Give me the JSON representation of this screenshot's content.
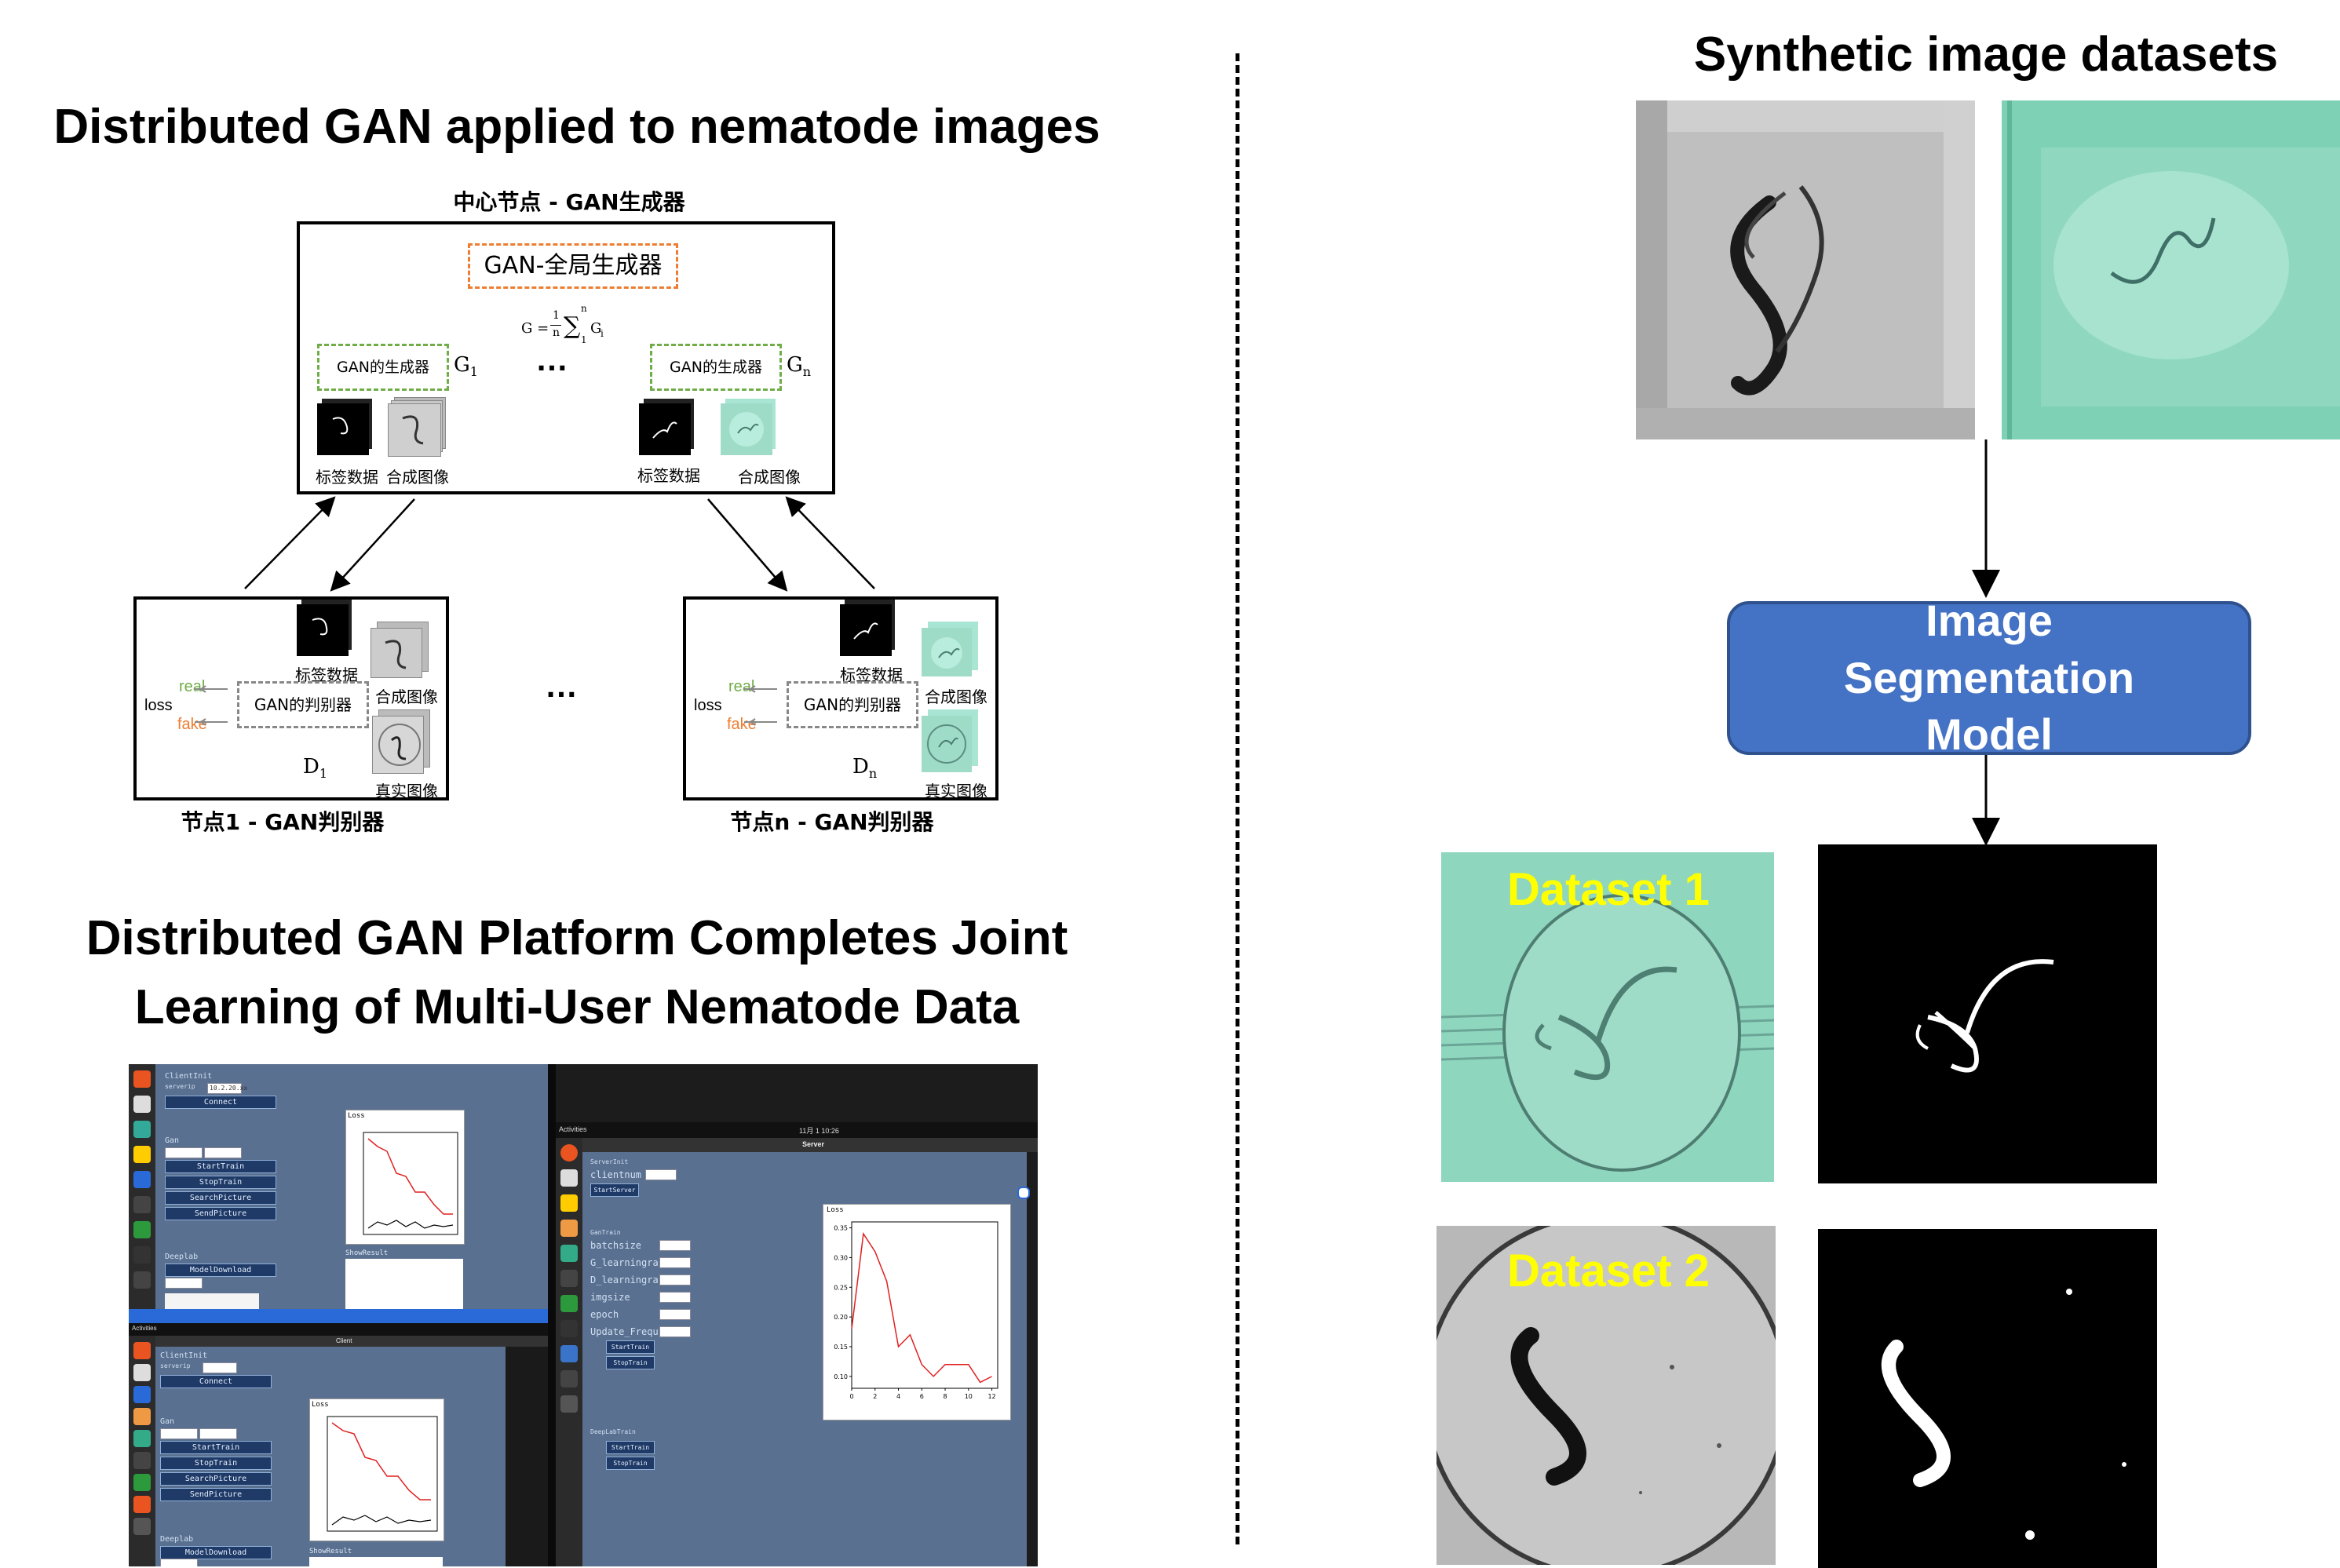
{
  "left": {
    "title": "Distributed GAN applied to nematode images",
    "center_node": {
      "label": "中心节点 - GAN生成器",
      "global_gen": "GAN-全局生成器",
      "formula_lhs": "G =",
      "formula_frac_num": "1",
      "formula_frac_den": "n",
      "formula_sum": "∑",
      "formula_sup": "n",
      "formula_sub": "1",
      "formula_term": "G",
      "formula_term_sub": "i",
      "gen_1": "GAN的生成器",
      "gen_n": "GAN的生成器",
      "g1": "G",
      "g1_sub": "1",
      "gn": "G",
      "gn_sub": "n",
      "ellipsis": "…",
      "label_data_1": "标签数据",
      "synth_1": "合成图像",
      "label_data_n": "标签数据",
      "synth_n": "合成图像"
    },
    "node_1": {
      "caption": "节点1 - GAN判别器",
      "label_data": "标签数据",
      "synth": "合成图像",
      "real_img": "真实图像",
      "disc": "GAN的判别器",
      "real": "real",
      "fake": "fake",
      "loss": "loss",
      "d": "D",
      "d_sub": "1"
    },
    "node_n": {
      "caption": "节点n - GAN判别器",
      "label_data": "标签数据",
      "synth": "合成图像",
      "real_img": "真实图像",
      "disc": "GAN的判别器",
      "real": "real",
      "fake": "fake",
      "loss": "loss",
      "d": "D",
      "d_sub": "n"
    },
    "nodes_ellipsis": "…",
    "title2_line1": "Distributed GAN Platform Completes Joint",
    "title2_line2": "Learning of Multi-User Nematode Data",
    "screenshot": {
      "client_top": {
        "client_init": "ClientInit",
        "server_ip": "serverip",
        "ip_value": "10.2.20.xx",
        "connect": "Connect",
        "gan": "Gan",
        "start_train": "StartTrain",
        "stop_train": "StopTrain",
        "search_picture": "SearchPicture",
        "send_picture": "SendPicture",
        "deeplab": "Deeplab",
        "model_download": "ModelDownload",
        "loss": "Loss",
        "show_result": "ShowResult"
      },
      "server": {
        "activities": "Activities",
        "clock": "11月 1  10:26",
        "window_title": "Server",
        "server_init": "ServerInit",
        "client_num": "clientnum",
        "start_server": "StartServer",
        "gan_train": "GanTrain",
        "batchsize": "batchsize",
        "g_lr": "G_learningra",
        "d_lr": "D_learningra",
        "imgsize": "imgsize",
        "epoch": "epoch",
        "update_freq": "Update_Frequ",
        "start_train": "StartTrain",
        "stop_train": "StopTrain",
        "deeplab_train": "DeepLabTrain",
        "dl_start": "StartTrain",
        "dl_stop": "StopTrain",
        "loss": "Loss"
      },
      "client_bottom": {
        "activities": "Activities",
        "window_title": "Client",
        "client_init": "ClientInit",
        "server_ip": "serverip",
        "connect": "Connect",
        "gan": "Gan",
        "start_train": "StartTrain",
        "stop_train": "StopTrain",
        "search_picture": "SearchPicture",
        "send_picture": "SendPicture",
        "deeplab": "Deeplab",
        "model_download": "ModelDownload",
        "loss": "Loss",
        "show_result": "ShowResult"
      }
    }
  },
  "right": {
    "title": "Synthetic image datasets",
    "model": "Image Segmentation Model",
    "dataset1": "Dataset 1",
    "dataset2": "Dataset 2",
    "model_fill": "#4472c4",
    "dataset_label_color": "#ffff00"
  },
  "chart_data": [
    {
      "type": "line",
      "title": "Loss",
      "x": [
        0,
        1,
        2,
        3,
        4,
        5,
        6,
        7,
        8,
        9,
        10,
        11,
        12
      ],
      "series": [
        {
          "values": [
            0.18,
            0.34,
            0.31,
            0.26,
            0.15,
            0.17,
            0.12,
            0.1,
            0.12,
            0.12,
            0.12,
            0.09,
            0.1
          ],
          "color": "#e02020"
        }
      ],
      "yticks": [
        0.1,
        0.15,
        0.2,
        0.25,
        0.3,
        0.35
      ],
      "xticks": [
        0,
        2,
        4,
        6,
        8,
        10,
        12
      ],
      "ylim": [
        0.08,
        0.36
      ],
      "xlim": [
        0,
        12.5
      ]
    }
  ]
}
